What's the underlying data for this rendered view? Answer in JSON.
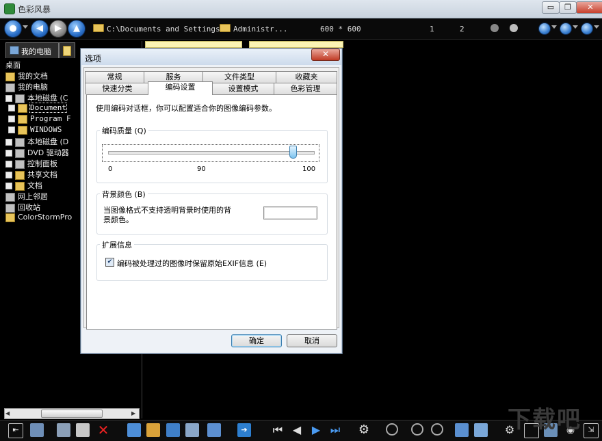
{
  "window": {
    "title": "色彩风暴",
    "minimize_label": "▭",
    "restore_label": "❐",
    "close_label": "✕"
  },
  "toolbar": {
    "path": "C:\\Documents and Settings",
    "folder": "Administr...",
    "image_size": "600 * 600",
    "page_current": "1",
    "page_total": "2",
    "back_icon": "arrow-left-icon",
    "up_icon": "arrow-up-icon"
  },
  "left_panel": {
    "tab_label": "我的电脑",
    "tree": [
      {
        "label": "桌面",
        "level": 0,
        "icon": "desktop-icon"
      },
      {
        "label": "我的文档",
        "level": 1,
        "icon": "documents-icon"
      },
      {
        "label": "我的电脑",
        "level": 1,
        "icon": "computer-icon"
      },
      {
        "label": "本地磁盘 (C",
        "level": 2,
        "icon": "drive-icon"
      },
      {
        "label": "Document",
        "level": 3,
        "icon": "folder-icon",
        "selected": true
      },
      {
        "label": "Program F",
        "level": 3,
        "icon": "folder-icon"
      },
      {
        "label": "WINDOWS",
        "level": 3,
        "icon": "folder-icon"
      },
      {
        "label": "本地磁盘 (D",
        "level": 2,
        "icon": "drive-icon"
      },
      {
        "label": "DVD 驱动器",
        "level": 2,
        "icon": "dvd-icon"
      },
      {
        "label": "控制面板",
        "level": 2,
        "icon": "control-panel-icon"
      },
      {
        "label": "共享文档",
        "level": 2,
        "icon": "folder-icon"
      },
      {
        "label": "文档",
        "level": 2,
        "icon": "folder-icon"
      },
      {
        "label": "网上邻居",
        "level": 1,
        "icon": "network-icon"
      },
      {
        "label": "回收站",
        "level": 1,
        "icon": "recycle-bin-icon"
      },
      {
        "label": "ColorStormPro",
        "level": 1,
        "icon": "folder-icon"
      }
    ]
  },
  "dialog": {
    "title": "选项",
    "close_label": "✕",
    "tabs_row1": [
      "常规",
      "服务",
      "文件类型",
      "收藏夹"
    ],
    "tabs_row2": [
      "快速分类",
      "编码设置",
      "设置模式",
      "色彩管理"
    ],
    "active_tab": "编码设置",
    "description": "使用编码对话框，你可以配置适合你的图像编码参数。",
    "quality": {
      "label": "编码质量 (Q)",
      "min_label": "0",
      "mid_label": "90",
      "max_label": "100",
      "value": 90
    },
    "background": {
      "label": "背景颜色 (B)",
      "text_line1": "当图像格式不支持透明背景时使用的背",
      "text_line2": "景颜色。",
      "color": "#ffffff"
    },
    "extended": {
      "label": "扩展信息",
      "checkbox_label": "编码被处理过的图像时保留原始EXIF信息 (E)",
      "checked": true
    },
    "ok_label": "确定",
    "cancel_label": "取消"
  },
  "watermark": "下载吧"
}
